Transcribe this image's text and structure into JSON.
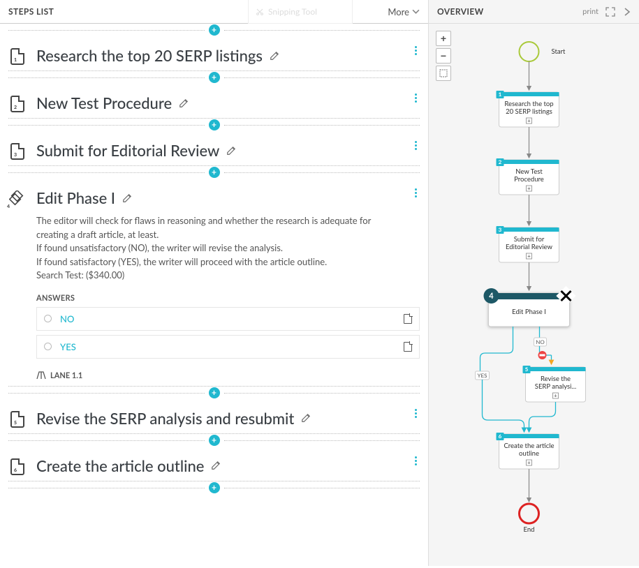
{
  "left": {
    "header_title": "STEPS LIST",
    "more_label": "More",
    "snip_ghost": "Snipping Tool"
  },
  "steps": [
    {
      "num": "1",
      "type": "doc",
      "title": "Research the top 20 SERP listings"
    },
    {
      "num": "2",
      "type": "doc",
      "title": "New Test Procedure"
    },
    {
      "num": "3",
      "type": "doc",
      "title": "Submit for Editorial Review"
    },
    {
      "num": "4",
      "type": "decision",
      "title": "Edit Phase I",
      "desc_lines": [
        "The editor will check for flaws in reasoning and whether the research is adequate for creating a draft article, at least.",
        "If found unsatisfactory (NO), the writer will revise the analysis.",
        "If found satisfactory (YES), the writer will proceed with the article outline.",
        "Search Test: ($340.00)"
      ],
      "answers_label": "ANSWERS",
      "answers": [
        {
          "label": "NO"
        },
        {
          "label": "YES"
        }
      ],
      "lane_label": "LANE 1.1"
    },
    {
      "num": "5",
      "type": "doc",
      "title": "Revise the SERP analysis and resubmit"
    },
    {
      "num": "6",
      "type": "doc",
      "title": "Create the article outline"
    }
  ],
  "right": {
    "title": "OVERVIEW",
    "print_label": "print",
    "start_label": "Start",
    "end_label": "End",
    "yes": "YES",
    "no": "NO",
    "nodes": {
      "n1": [
        "Research the top",
        "20 SERP listings"
      ],
      "n2": [
        "New Test",
        "Procedure"
      ],
      "n3": [
        "Submit for",
        "Editorial Review"
      ],
      "n4": [
        "Edit Phase I"
      ],
      "n5": [
        "Revise the",
        "SERP analysi..."
      ],
      "n6": [
        "Create the article",
        "outline"
      ]
    },
    "selected_num": "4"
  }
}
